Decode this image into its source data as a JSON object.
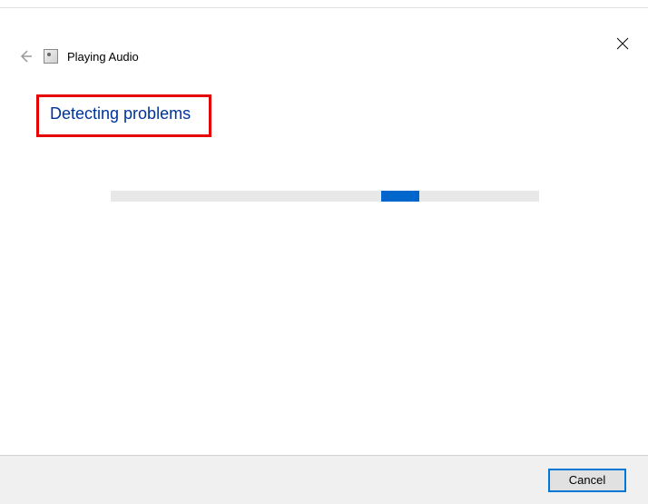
{
  "header": {
    "title": "Playing Audio"
  },
  "main": {
    "status_text": "Detecting problems"
  },
  "footer": {
    "cancel_label": "Cancel"
  }
}
